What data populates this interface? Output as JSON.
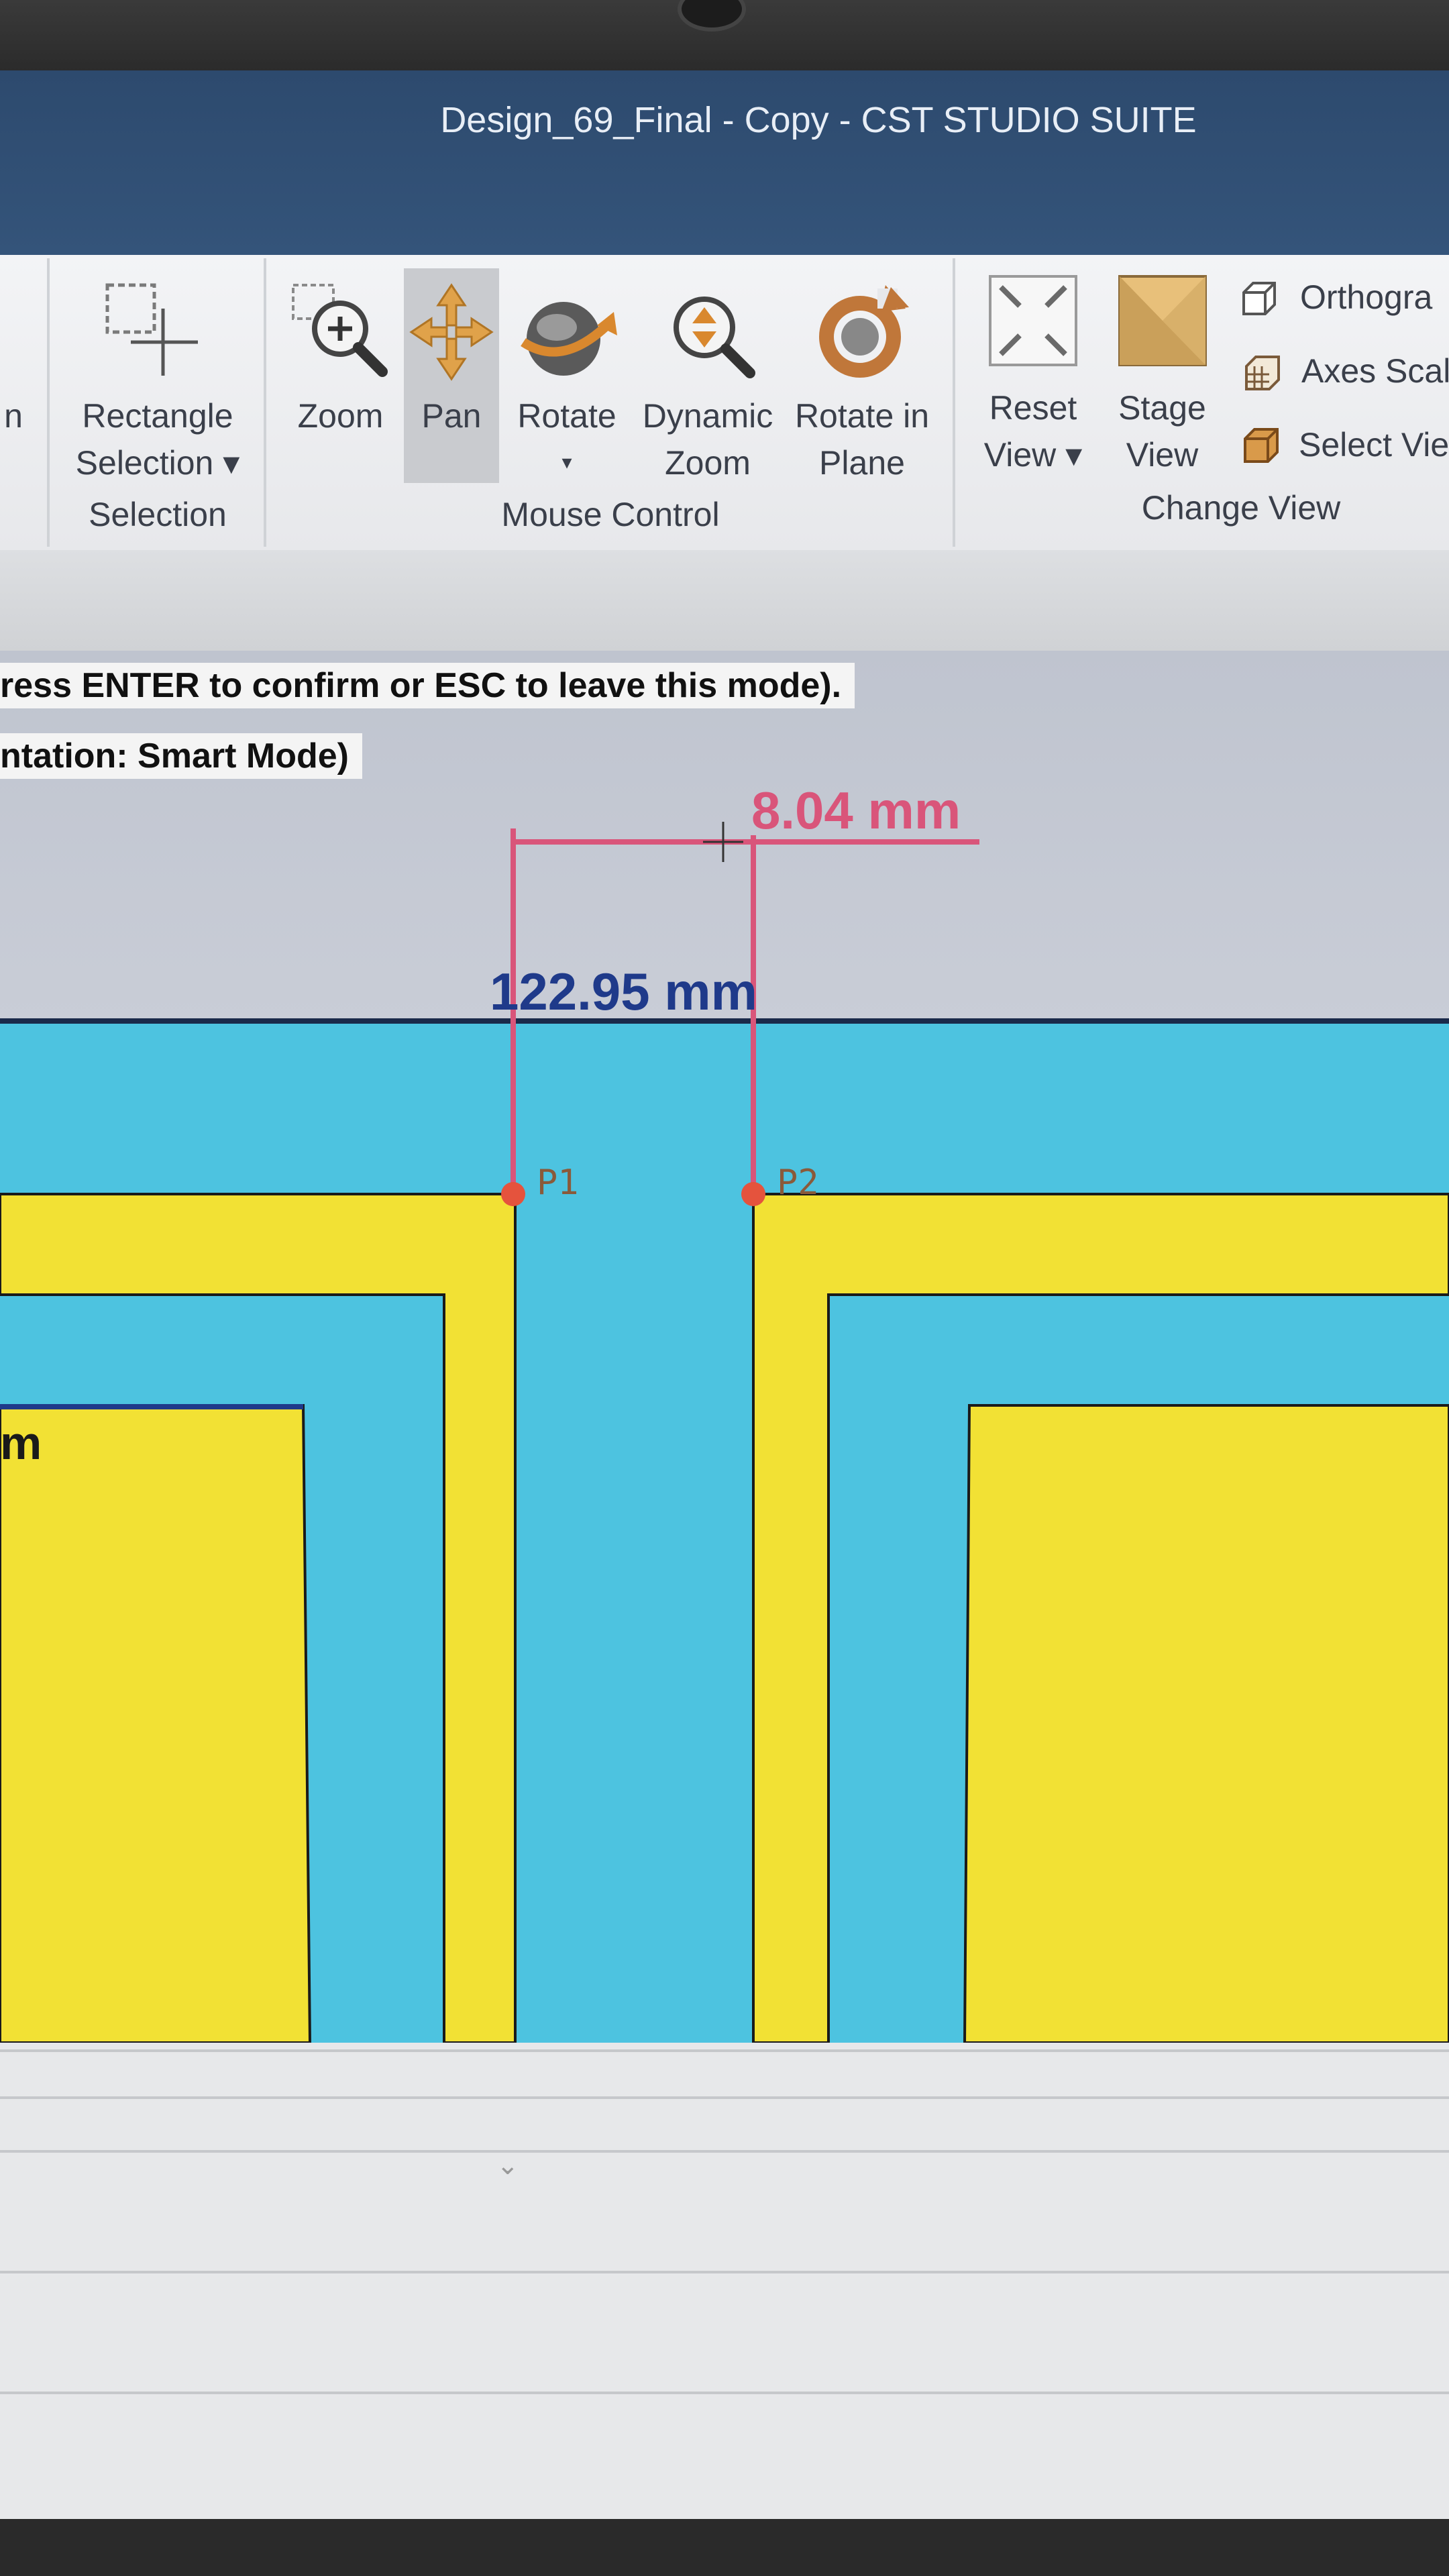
{
  "window": {
    "title": "Design_69_Final - Copy - CST STUDIO SUITE"
  },
  "ribbon": {
    "partial_left_label": "n",
    "selection_group": {
      "label": "Selection",
      "rectangle_selection": {
        "line1": "Rectangle",
        "line2": "Selection ▾"
      }
    },
    "mouse_control_group": {
      "label": "Mouse Control",
      "zoom": "Zoom",
      "pan": "Pan",
      "rotate": {
        "line1": "Rotate",
        "line2": "▾"
      },
      "dynamic_zoom": {
        "line1": "Dynamic",
        "line2": "Zoom"
      },
      "rotate_in_plane": {
        "line1": "Rotate in",
        "line2": "Plane"
      }
    },
    "change_view_group": {
      "label": "Change View",
      "reset_view": {
        "line1": "Reset",
        "line2": "View ▾"
      },
      "stage_view": {
        "line1": "Stage",
        "line2": "View"
      },
      "orthographic": "Orthogra",
      "axes_scaling": "Axes Scali",
      "select_view": "Select Vie"
    }
  },
  "viewport": {
    "message_1": "ress ENTER to confirm or ESC to leave this mode).",
    "message_2": "ntation: Smart Mode)",
    "dimension_distance": "8.04 mm",
    "dimension_total": "122.95 mm",
    "point_1": "P1",
    "point_2": "P2",
    "partial_label": "m"
  },
  "colors": {
    "substrate": "#4dc3e0",
    "copper": "#f2e134",
    "dimension_line": "#d9557a",
    "dimension_text_blue": "#1f3a8a",
    "point_marker": "#e5533d",
    "title_bar": "#2f4d72"
  },
  "icons": [
    "rectangle-selection-icon",
    "zoom-icon",
    "pan-icon",
    "rotate-icon",
    "dynamic-zoom-icon",
    "rotate-in-plane-icon",
    "reset-view-icon",
    "stage-view-icon",
    "orthographic-icon",
    "axes-scaling-icon",
    "select-view-icon"
  ]
}
